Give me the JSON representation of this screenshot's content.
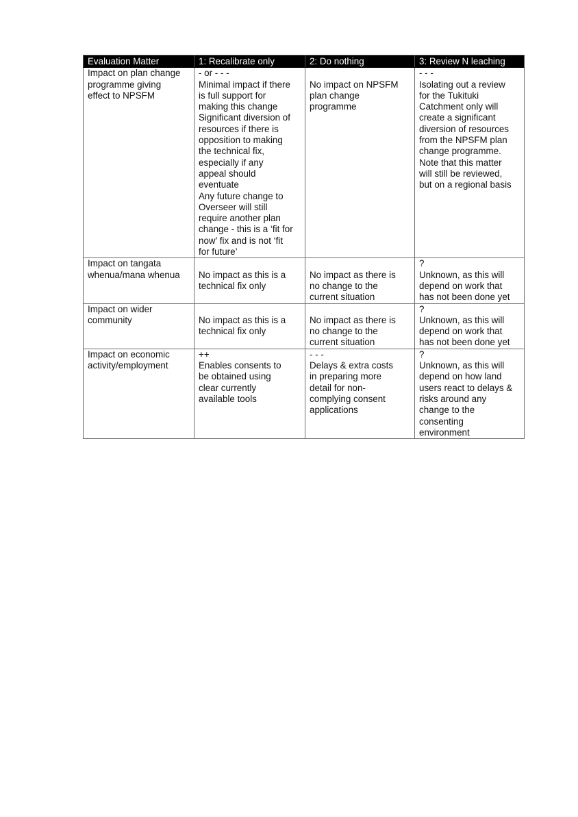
{
  "table": {
    "headers": [
      "Evaluation Matter",
      "1: Recalibrate only",
      "2: Do nothing",
      "3: Review N leaching"
    ],
    "rows": [
      {
        "matter": [
          "Impact on plan change",
          "programme giving",
          "effect to NPSFM"
        ],
        "option1": [
          "- or - - -",
          "Minimal impact if there",
          "is full support for",
          "making this change",
          "Significant diversion of",
          "resources if there is",
          "opposition to making",
          "the technical fix,",
          "especially if any",
          "appeal should",
          "eventuate",
          "Any future change to",
          "Overseer will still",
          "require another plan",
          "change - this is a ‘fit for",
          "now’ fix and is not ‘fit",
          "for future’"
        ],
        "option2": [
          "",
          "No impact on NPSFM",
          "plan change",
          "programme"
        ],
        "option3": [
          "- - -",
          "Isolating out a review",
          "for the Tukituki",
          "Catchment only will",
          "create a significant",
          "diversion of resources",
          "from the NPSFM plan",
          "change programme.",
          "Note that this matter",
          "will still be reviewed,",
          "but on a regional basis"
        ]
      },
      {
        "matter": [
          "Impact on tangata",
          "whenua/mana whenua"
        ],
        "option1": [
          "",
          "No impact as this is a",
          "technical fix only"
        ],
        "option2": [
          "",
          "No impact as there is",
          "no change to the",
          "current situation"
        ],
        "option3": [
          "?",
          "Unknown, as this will",
          "depend on work that",
          "has not been done yet"
        ]
      },
      {
        "matter": [
          "Impact on wider",
          "community"
        ],
        "option1": [
          "",
          "No impact as this is a",
          "technical fix only"
        ],
        "option2": [
          "",
          "No impact as there is",
          "no change to the",
          "current situation"
        ],
        "option3": [
          "?",
          "Unknown, as this will",
          "depend on work that",
          "has not been done yet"
        ]
      },
      {
        "matter": [
          "Impact on economic",
          "activity/employment"
        ],
        "option1": [
          "++",
          "Enables consents to",
          "be obtained using",
          "clear currently",
          "available tools"
        ],
        "option2": [
          "- - -",
          "Delays & extra costs",
          "in preparing more",
          "detail for non-",
          "complying consent",
          "applications"
        ],
        "option3": [
          "?",
          "Unknown, as this will",
          "depend on how land",
          "users react to delays &",
          "risks around any",
          "change to the",
          "consenting",
          "environment"
        ]
      }
    ]
  }
}
